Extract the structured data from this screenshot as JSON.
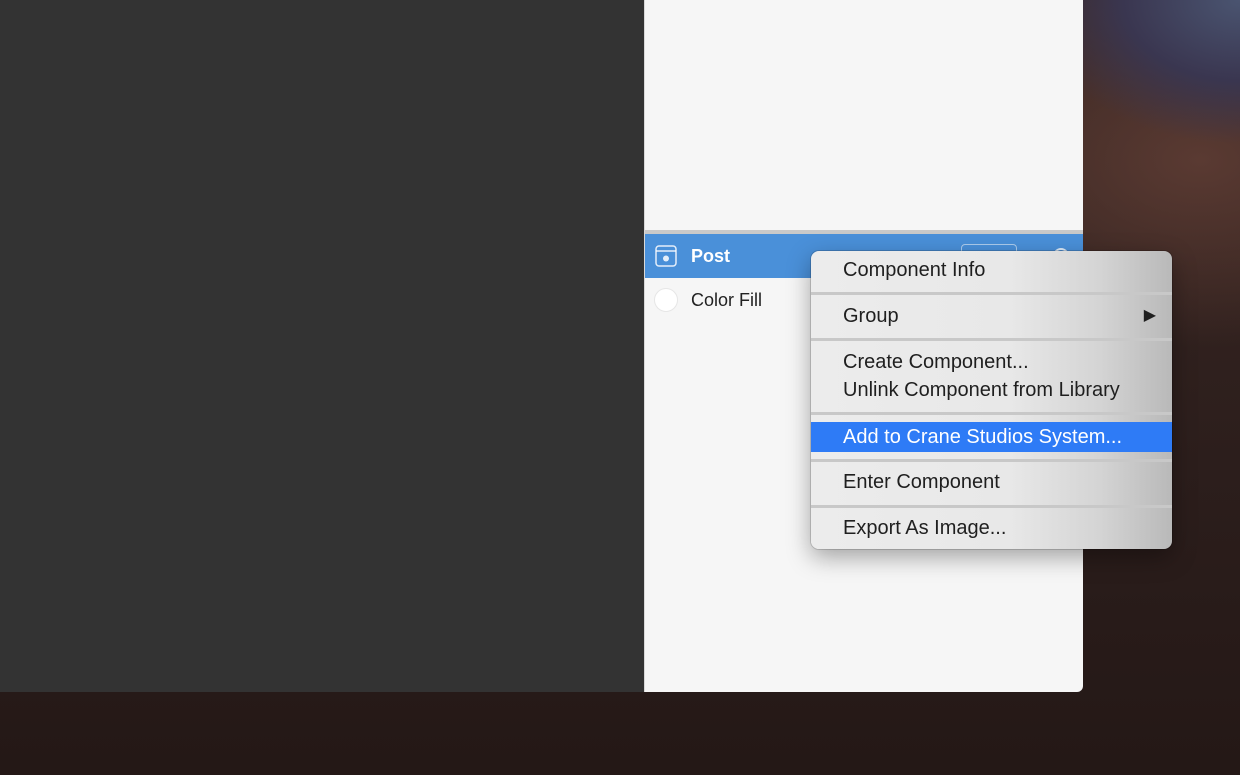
{
  "layers": {
    "selected": {
      "label": "Post",
      "icon": "component-icon"
    },
    "items": [
      {
        "label": "Color Fill",
        "icon": "color-fill-swatch",
        "swatch_color": "#ffffff"
      }
    ]
  },
  "context_menu": {
    "items": [
      {
        "label": "Component Info"
      },
      {
        "label": "Group",
        "submenu_arrow": "▶"
      },
      {
        "label": "Create Component..."
      },
      {
        "label": "Unlink Component from Library"
      },
      {
        "label": "Add to Crane Studios System...",
        "highlighted": true
      },
      {
        "label": "Enter Component"
      },
      {
        "label": "Export As Image..."
      }
    ]
  },
  "colors": {
    "selection": "#4a90d9",
    "menu_highlight": "#2e7bf6",
    "canvas": "#333333",
    "panel": "#f6f6f6"
  }
}
